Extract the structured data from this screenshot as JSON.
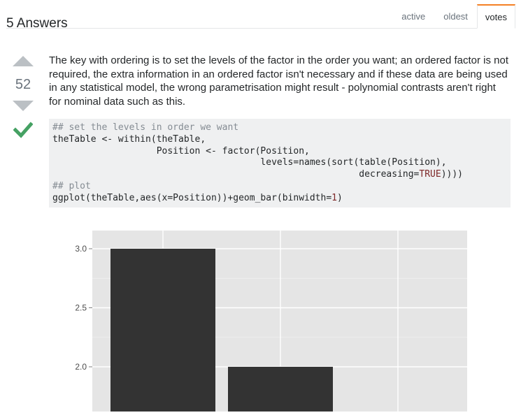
{
  "header": {
    "title": "5 Answers",
    "tabs": [
      {
        "label": "active",
        "selected": false
      },
      {
        "label": "oldest",
        "selected": false
      },
      {
        "label": "votes",
        "selected": true
      }
    ]
  },
  "vote": {
    "count": "52",
    "up_icon": "up-arrow-icon",
    "down_icon": "down-arrow-icon",
    "accepted_icon": "checkmark-icon",
    "accepted_color": "#45a163"
  },
  "answer": {
    "text": "The key with ordering is to set the levels of the factor in the order you want; an ordered factor is not required, the extra information in an ordered factor isn't necessary and if these data are being used in any statistical model, the wrong parametrisation might result - polynomial contrasts aren't right for nominal data such as this."
  },
  "code": {
    "lines": [
      [
        {
          "t": "## set the levels in order we want",
          "c": "com"
        }
      ],
      [
        {
          "t": "theTable <- within(theTable,",
          "c": ""
        }
      ],
      [
        {
          "t": "                   Position <- factor(Position,",
          "c": ""
        }
      ],
      [
        {
          "t": "                                      levels=names(sort(table(Position),",
          "c": ""
        }
      ],
      [
        {
          "t": "                                                        decreasing=",
          "c": ""
        },
        {
          "t": "TRUE",
          "c": "kw"
        },
        {
          "t": "))))",
          "c": ""
        }
      ],
      [
        {
          "t": "## plot",
          "c": "com"
        }
      ],
      [
        {
          "t": "ggplot(theTable,aes(x=Position))+geom_bar(binwidth=",
          "c": ""
        },
        {
          "t": "1",
          "c": "kw"
        },
        {
          "t": ")",
          "c": ""
        }
      ]
    ]
  },
  "chart_data": {
    "type": "bar",
    "categories": [
      "",
      "",
      ""
    ],
    "values": [
      3,
      2,
      null
    ],
    "yticks": [
      "2.0",
      "2.5",
      "3.0"
    ],
    "ytick_values": [
      2.0,
      2.5,
      3.0
    ],
    "ylim_visible": [
      1.7,
      3.2
    ],
    "bar_color": "#333333",
    "panel_color": "#e5e5e5",
    "grid": true,
    "title": "",
    "xlabel": "",
    "ylabel": ""
  }
}
